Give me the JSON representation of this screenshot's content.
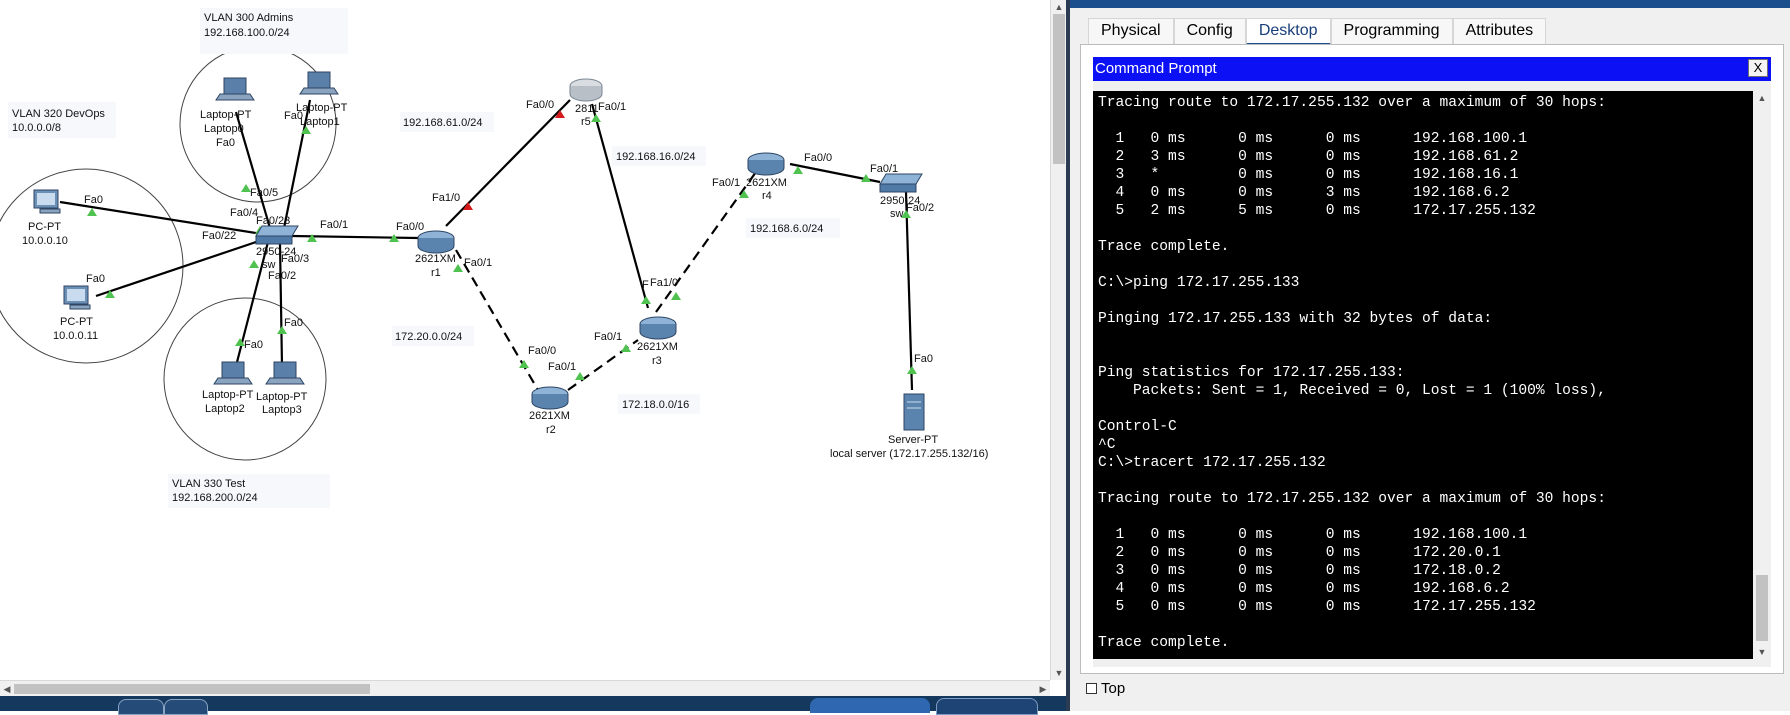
{
  "topology": {
    "region_labels": {
      "vlan300": [
        "VLAN 300 Admins",
        "192.168.100.0/24"
      ],
      "vlan320": [
        "VLAN 320 DevOps",
        "10.0.0.0/8"
      ],
      "vlan330": [
        "VLAN 330 Test",
        "192.168.200.0/24"
      ]
    },
    "network_labels": {
      "net_61": "192.168.61.0/24",
      "net_16": "192.168.16.0/24",
      "net_6": "192.168.6.0/24",
      "net_20": "172.20.0.0/24",
      "net_18": "172.18.0.0/16"
    },
    "devices": {
      "laptop0": [
        "Laptop-PT",
        "Laptop0"
      ],
      "laptop1": [
        "Laptop-PT",
        "Laptop1"
      ],
      "laptop2": [
        "Laptop-PT",
        "Laptop2"
      ],
      "laptop3": [
        "Laptop-PT",
        "Laptop3"
      ],
      "pc_a": [
        "PC-PT",
        "10.0.0.10"
      ],
      "pc_b": [
        "PC-PT",
        "10.0.0.11"
      ],
      "sw_left": [
        "2950-24",
        "sw"
      ],
      "r1": [
        "2621XM",
        "r1"
      ],
      "r2": [
        "2621XM",
        "r2"
      ],
      "r3": [
        "2621XM",
        "r3"
      ],
      "r4": [
        "2621XM",
        "r4"
      ],
      "r5": [
        "2811",
        "r5"
      ],
      "sw_right": [
        "2950-24",
        "sw"
      ],
      "server": [
        "Server-PT",
        "local server (172.17.255.132/16)"
      ]
    },
    "ports": {
      "l0_fa0": "Fa0",
      "l1_fa0": "Fa0",
      "sw_fa05": "Fa0/5",
      "sw_fa04": "Fa0/4",
      "sw_fa023": "Fa0/23",
      "sw_fa022": "Fa0/22",
      "sw_fa03": "Fa0/3",
      "sw_fa02": "Fa0/2",
      "sw_fa01": "Fa0/1",
      "pca_fa0": "Fa0",
      "pcb_fa0": "Fa0",
      "l2_fa0": "Fa0",
      "l3_fa0": "Fa0",
      "r1_fa00": "Fa0/0",
      "r1_fa10": "Fa1/0",
      "r1_fa01": "Fa0/1",
      "r5_fa00": "Fa0/0",
      "r5_fa01": "Fa0/1",
      "r2_fa00": "Fa0/0",
      "r2_fa01": "Fa0/1",
      "r3_fa01": "Fa0/1",
      "r3_fa10": "Fa1/0",
      "r3_f": "F",
      "r4_fa01": "Fa0/1",
      "r4_fa00": "Fa0/0",
      "swr_fa01": "Fa0/1",
      "swr_fa02": "Fa0/2",
      "srv_fa0": "Fa0"
    }
  },
  "panel": {
    "tabs": [
      "Physical",
      "Config",
      "Desktop",
      "Programming",
      "Attributes"
    ],
    "active_tab": "Desktop",
    "cmd_title": "Command Prompt",
    "close_label": "X",
    "top_checkbox_label": "Top",
    "terminal_lines": [
      "Tracing route to 172.17.255.132 over a maximum of 30 hops:",
      "",
      "  1   0 ms      0 ms      0 ms      192.168.100.1",
      "  2   3 ms      0 ms      0 ms      192.168.61.2",
      "  3   *         0 ms      0 ms      192.168.16.1",
      "  4   0 ms      0 ms      3 ms      192.168.6.2",
      "  5   2 ms      5 ms      0 ms      172.17.255.132",
      "",
      "Trace complete.",
      "",
      "C:\\>ping 172.17.255.133",
      "",
      "Pinging 172.17.255.133 with 32 bytes of data:",
      "",
      "",
      "Ping statistics for 172.17.255.133:",
      "    Packets: Sent = 1, Received = 0, Lost = 1 (100% loss),",
      "",
      "Control-C",
      "^C",
      "C:\\>tracert 172.17.255.132",
      "",
      "Tracing route to 172.17.255.132 over a maximum of 30 hops:",
      "",
      "  1   0 ms      0 ms      0 ms      192.168.100.1",
      "  2   0 ms      0 ms      0 ms      172.20.0.1",
      "  3   0 ms      0 ms      0 ms      172.18.0.2",
      "  4   0 ms      0 ms      0 ms      192.168.6.2",
      "  5   0 ms      0 ms      0 ms      172.17.255.132",
      "",
      "Trace complete."
    ]
  },
  "colors": {
    "link_up": "#4fc24f",
    "link_down": "#d41a1a",
    "title_bar": "#0b10f5",
    "active_tab": "#1a4e8c"
  }
}
